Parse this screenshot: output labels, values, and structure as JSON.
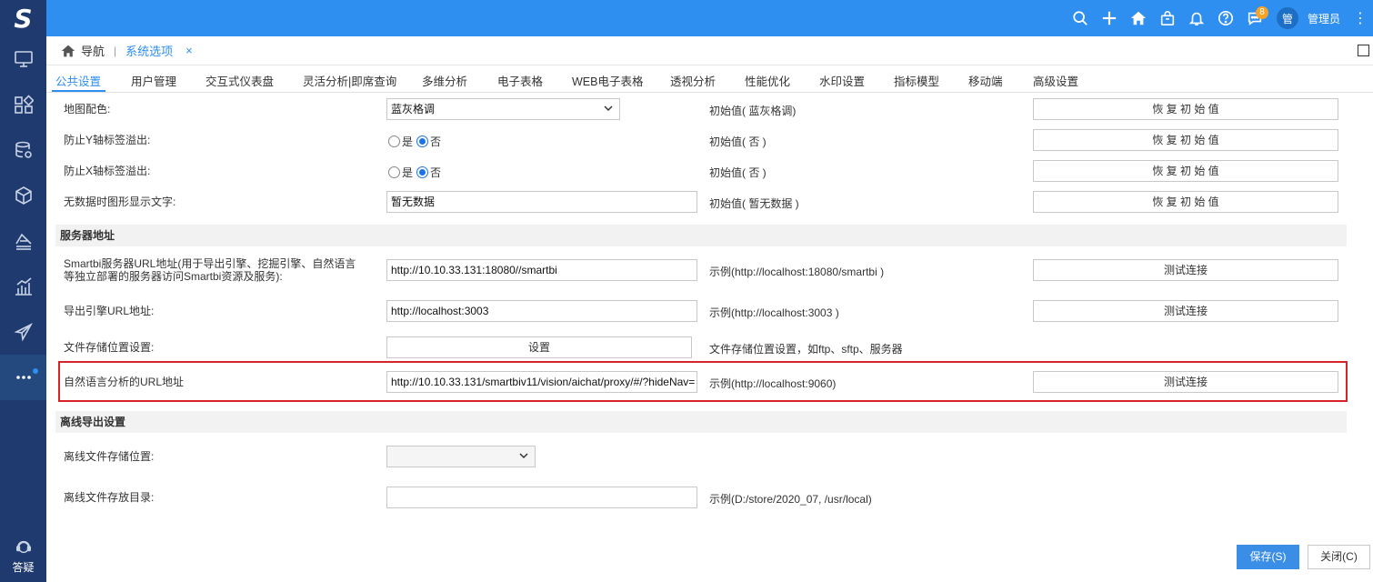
{
  "logo": {
    "text": "S"
  },
  "topbar": {
    "badge_count": "8",
    "avatar_text": "管",
    "username": "管理员",
    "icons": [
      "search-icon",
      "plus-icon",
      "home-icon",
      "bag-icon",
      "bell-icon",
      "help-icon",
      "chat-icon",
      "more-vertical-icon"
    ]
  },
  "sidebar": {
    "items": [
      "monitor-icon",
      "grid-icon",
      "database-icon",
      "cube-icon",
      "layers-icon",
      "chart-icon",
      "send-icon",
      "more-icon"
    ],
    "help_label": "答疑"
  },
  "breadcrumb": {
    "nav": "导航",
    "sep": "|",
    "current": "系统选项",
    "close": "×"
  },
  "tabs": [
    "公共设置",
    "用户管理",
    "交互式仪表盘",
    "灵活分析|即席查询",
    "多维分析",
    "电子表格",
    "WEB电子表格",
    "透视分析",
    "性能优化",
    "水印设置",
    "指标模型",
    "移动端",
    "高级设置"
  ],
  "general": {
    "map_color": {
      "label": "地图配色:",
      "value": "蓝灰格调",
      "hint": "初始值( 蓝灰格调)",
      "button": "恢 复 初 始 值"
    },
    "y_overflow": {
      "label": "防止Y轴标签溢出:",
      "yes": "是",
      "no": "否",
      "hint": "初始值( 否 )",
      "button": "恢 复 初 始 值"
    },
    "x_overflow": {
      "label": "防止X轴标签溢出:",
      "yes": "是",
      "no": "否",
      "hint": "初始值( 否 )",
      "button": "恢 复 初 始 值"
    },
    "no_data_text": {
      "label": "无数据时图形显示文字:",
      "value": "暂无数据",
      "hint": "初始值( 暂无数据 )",
      "button": "恢 复 初 始 值"
    }
  },
  "server": {
    "section_title": "服务器地址",
    "smartbi_url": {
      "label_line1": "Smartbi服务器URL地址(用于导出引擎、挖掘引擎、自然语言",
      "label_line2": "等独立部署的服务器访问Smartbi资源及服务):",
      "value": "http://10.10.33.131:18080//smartbi",
      "hint": "示例(http://localhost:18080/smartbi )",
      "button": "测试连接"
    },
    "export_url": {
      "label": "导出引擎URL地址:",
      "value": "http://localhost:3003",
      "hint": "示例(http://localhost:3003 )",
      "button": "测试连接"
    },
    "file_storage": {
      "label": "文件存储位置设置:",
      "button": "设置",
      "hint": "文件存储位置设置，如ftp、sftp、服务器"
    },
    "nlp_url": {
      "label": "自然语言分析的URL地址",
      "value": "http://10.10.33.131/smartbiv11/vision/aichat/proxy/#/?hideNav=",
      "hint": "示例(http://localhost:9060)",
      "button": "测试连接"
    }
  },
  "offline": {
    "section_title": "离线导出设置",
    "storage_location": {
      "label": "离线文件存储位置:",
      "value": ""
    },
    "storage_dir": {
      "label": "离线文件存放目录:",
      "value": "",
      "hint": "示例(D:/store/2020_07, /usr/local)"
    }
  },
  "footer": {
    "save": "保存(S)",
    "close": "关闭(C)"
  },
  "colors": {
    "primary": "#2f8ff0",
    "sidebar": "#1f3a6e",
    "highlight": "#d9232a"
  }
}
